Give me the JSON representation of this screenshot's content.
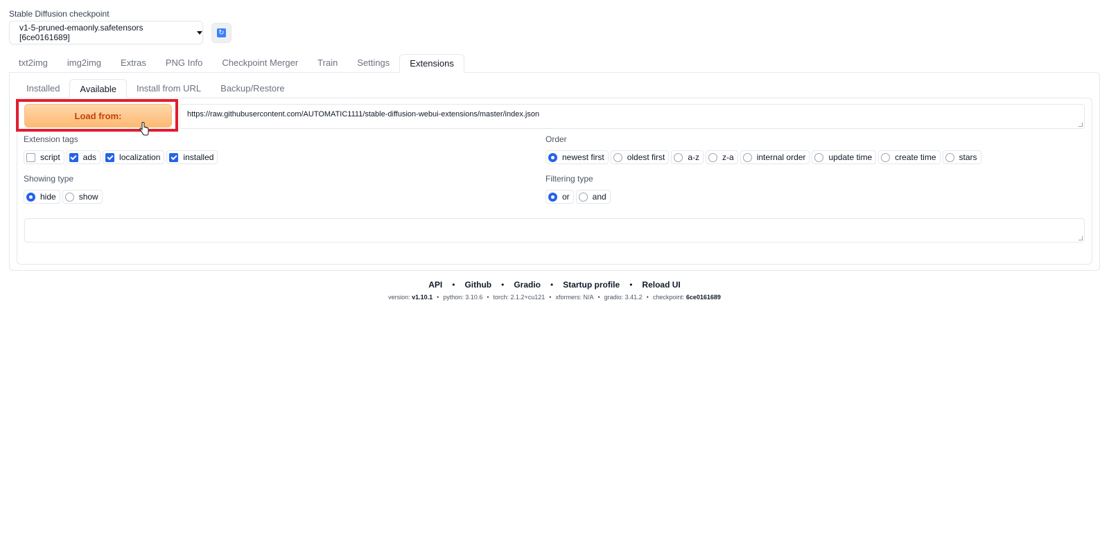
{
  "checkpoint": {
    "label": "Stable Diffusion checkpoint",
    "value": "v1-5-pruned-emaonly.safetensors [6ce0161689]",
    "refresh_icon": "refresh-icon"
  },
  "main_tabs": [
    "txt2img",
    "img2img",
    "Extras",
    "PNG Info",
    "Checkpoint Merger",
    "Train",
    "Settings",
    "Extensions"
  ],
  "main_tab_active": "Extensions",
  "sub_tabs": [
    "Installed",
    "Available",
    "Install from URL",
    "Backup/Restore"
  ],
  "sub_tab_active": "Available",
  "load_button": "Load from:",
  "url": "https://raw.githubusercontent.com/AUTOMATIC1111/stable-diffusion-webui-extensions/master/index.json",
  "extension_tags": {
    "label": "Extension tags",
    "options": [
      {
        "label": "script",
        "checked": false
      },
      {
        "label": "ads",
        "checked": true
      },
      {
        "label": "localization",
        "checked": true
      },
      {
        "label": "installed",
        "checked": true
      }
    ]
  },
  "order": {
    "label": "Order",
    "options": [
      "newest first",
      "oldest first",
      "a-z",
      "z-a",
      "internal order",
      "update time",
      "create time",
      "stars"
    ],
    "selected": "newest first"
  },
  "showing_type": {
    "label": "Showing type",
    "options": [
      "hide",
      "show"
    ],
    "selected": "hide"
  },
  "filtering_type": {
    "label": "Filtering type",
    "options": [
      "or",
      "and"
    ],
    "selected": "or"
  },
  "footer": {
    "links": [
      "API",
      "Github",
      "Gradio",
      "Startup profile",
      "Reload UI"
    ],
    "separator": "•",
    "version_label": "version:",
    "version": "v1.10.1",
    "python": "python: 3.10.6",
    "torch": "torch: 2.1.2+cu121",
    "xformers": "xformers: N/A",
    "gradio": "gradio: 3.41.2",
    "checkpoint_label": "checkpoint:",
    "checkpoint": "6ce0161689"
  },
  "colors": {
    "accent": "#2563eb",
    "load_button_text": "#c2410c",
    "highlight_border": "#e11d2e"
  }
}
